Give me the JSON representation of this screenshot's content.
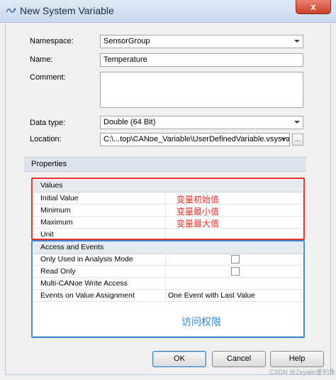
{
  "window": {
    "title": "New System Variable",
    "close_label": "x"
  },
  "form": {
    "namespace_label": "Namespace:",
    "namespace_value": "SensorGroup",
    "name_label": "Name:",
    "name_value": "Temperature",
    "comment_label": "Comment:",
    "comment_value": "",
    "datatype_label": "Data type:",
    "datatype_value": "Double (64 Bit)",
    "location_label": "Location:",
    "location_value": "C:\\...top\\CANoe_Variable\\UserDefinedVariable.vsysvar",
    "location_browse_label": "..."
  },
  "properties": {
    "header": "Properties",
    "values_header": "Values",
    "values_rows": [
      {
        "name": "Initial Value",
        "value": ""
      },
      {
        "name": "Minimum",
        "value": ""
      },
      {
        "name": "Maximum",
        "value": ""
      },
      {
        "name": "Unit",
        "value": ""
      }
    ],
    "access_header": "Access and Events",
    "access_rows": [
      {
        "name": "Only Used in Analysis Mode",
        "value": ""
      },
      {
        "name": "Read Only",
        "value": ""
      },
      {
        "name": "Multi-CANoe Write Access",
        "value": ""
      },
      {
        "name": "Events on Value Assignment",
        "value": "One Event with Last Value"
      }
    ]
  },
  "annotations": {
    "initial": "变量初始值",
    "min": "变量最小值",
    "max": "变量最大值",
    "access": "访问权限"
  },
  "buttons": {
    "ok": "OK",
    "cancel": "Cancel",
    "help": "Help"
  },
  "watermark": "CSDN @Zeyalin爱钓鱼",
  "colors": {
    "red_annotation": "#e8302a",
    "blue_annotation": "#3f8fd8"
  }
}
